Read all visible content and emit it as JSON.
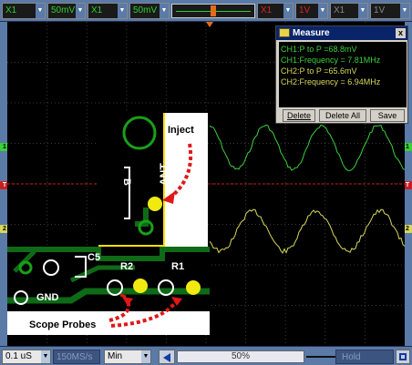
{
  "toolbar": {
    "ch1_coupling": "X1",
    "ch1_volts": "50mV",
    "ch1_probe": "X1",
    "ch2_volts": "50mV",
    "trigger_value": "0",
    "ch3_probe": "X1",
    "ch3_volts": "1V",
    "ch4_probe": "X1",
    "ch4_volts": "1V"
  },
  "channel_markers": {
    "ch1": "1",
    "trigger": "T",
    "ch2": "2",
    "right_ch1": "1",
    "right_trigger": "T",
    "right_ch2": "2"
  },
  "measure": {
    "title": "Measure",
    "close": "x",
    "lines": [
      "CH1:P to P =68.8mV",
      "CH1:Frequency = 7.81MHz",
      "CH2:P to P =65.6mV",
      "CH2:Frequency = 6.94MHz"
    ],
    "delete_label": "Delete",
    "delete_all_label": "Delete All",
    "save_label": "Save"
  },
  "pcb": {
    "inject_label": "Inject",
    "ant_label": "ANT",
    "c5_label": "C5",
    "r2_label": "R2",
    "r1_label": "R1",
    "gnd_label": "GND",
    "probes_label": "Scope Probes",
    "edge_label": "B"
  },
  "bottombar": {
    "timebase": "0.1 uS",
    "sample_rate": "150MS/s",
    "mode": "Min",
    "zoom": "50%",
    "hold": "Hold"
  },
  "colors": {
    "ch1": "#3ad13a",
    "ch2": "#d8d85a",
    "trigger": "#c81e1e",
    "toolbar": "#5a7aa8",
    "pcb_green": "#0e6a16",
    "probe_dot": "#f0ea10",
    "arrow": "#e01818"
  }
}
